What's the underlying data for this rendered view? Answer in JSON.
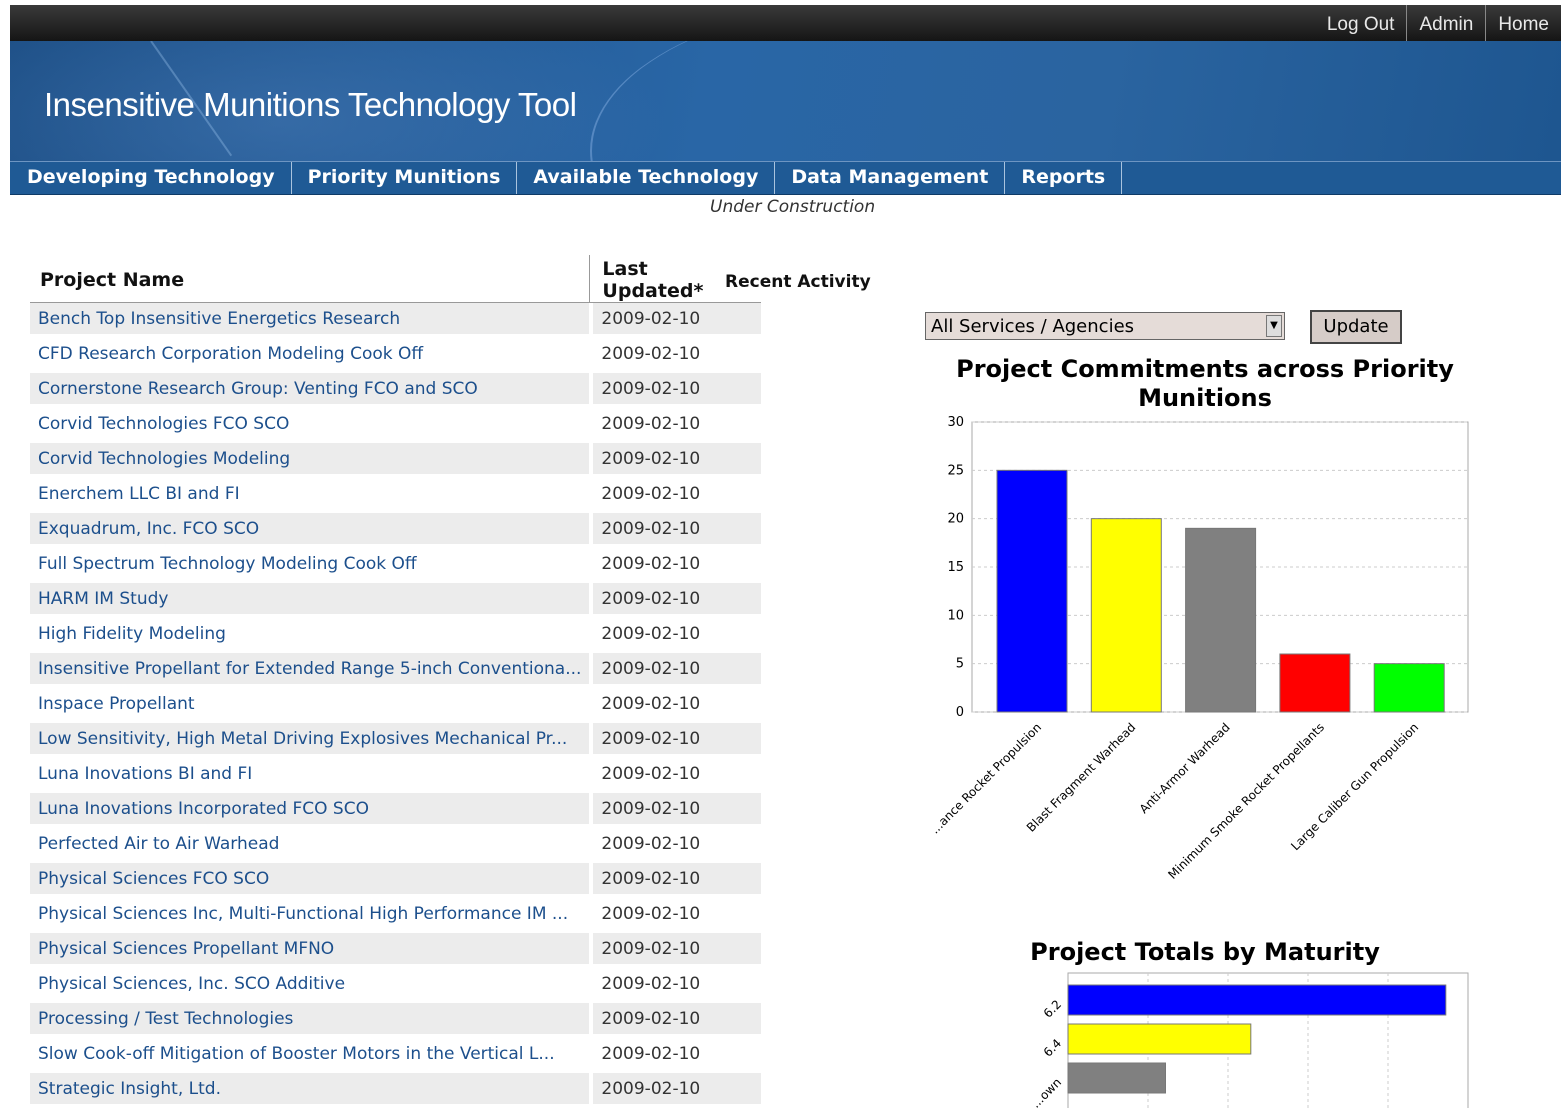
{
  "top_links": [
    "Log Out",
    "Admin",
    "Home"
  ],
  "app_title": "Insensitive Munitions Technology Tool",
  "nav_tabs": [
    "Developing Technology",
    "Priority Munitions",
    "Available Technology",
    "Data Management",
    "Reports"
  ],
  "status_text": "Under Construction",
  "table": {
    "headers": [
      "Project Name",
      "Last Updated*"
    ],
    "rows": [
      [
        "Bench Top Insensitive Energetics Research",
        "2009-02-10"
      ],
      [
        "CFD Research Corporation Modeling Cook Off",
        "2009-02-10"
      ],
      [
        "Cornerstone Research Group: Venting FCO and SCO",
        "2009-02-10"
      ],
      [
        "Corvid Technologies FCO SCO",
        "2009-02-10"
      ],
      [
        "Corvid Technologies Modeling",
        "2009-02-10"
      ],
      [
        "Enerchem LLC BI and FI",
        "2009-02-10"
      ],
      [
        "Exquadrum, Inc. FCO SCO",
        "2009-02-10"
      ],
      [
        "Full Spectrum Technology Modeling Cook Off",
        "2009-02-10"
      ],
      [
        "HARM IM Study",
        "2009-02-10"
      ],
      [
        "High Fidelity Modeling",
        "2009-02-10"
      ],
      [
        "Insensitive Propellant for Extended Range 5-inch Conventiona...",
        "2009-02-10"
      ],
      [
        "Inspace Propellant",
        "2009-02-10"
      ],
      [
        "Low Sensitivity, High Metal Driving Explosives Mechanical Pr...",
        "2009-02-10"
      ],
      [
        "Luna Inovations BI and FI",
        "2009-02-10"
      ],
      [
        "Luna Inovations Incorporated FCO SCO",
        "2009-02-10"
      ],
      [
        "Perfected Air to Air Warhead",
        "2009-02-10"
      ],
      [
        "Physical Sciences FCO SCO",
        "2009-02-10"
      ],
      [
        "Physical Sciences Inc, Multi-Functional High Performance IM ...",
        "2009-02-10"
      ],
      [
        "Physical Sciences Propellant MFNO",
        "2009-02-10"
      ],
      [
        "Physical Sciences, Inc. SCO Additive",
        "2009-02-10"
      ],
      [
        "Processing / Test Technologies",
        "2009-02-10"
      ],
      [
        "Slow Cook-off Mitigation of Booster Motors in the Vertical L...",
        "2009-02-10"
      ],
      [
        "Strategic Insight, Ltd.",
        "2009-02-10"
      ]
    ]
  },
  "recent_activity_label": "Recent Activity",
  "filter": {
    "selected": "All Services / Agencies",
    "button": "Update"
  },
  "chart_data": [
    {
      "type": "bar",
      "title": "Project Commitments across Priority Munitions",
      "categories": [
        "...ance Rocket Propulsion",
        "Blast Fragment Warhead",
        "Anti-Armor Warhead",
        "Minimum Smoke Rocket Propellants",
        "Large Caliber Gun Propulsion"
      ],
      "values": [
        25,
        20,
        19,
        6,
        5
      ],
      "colors": [
        "#0000ff",
        "#ffff00",
        "#808080",
        "#ff0000",
        "#00ff00"
      ],
      "ylim": [
        0,
        30
      ],
      "yticks": [
        0,
        5,
        10,
        15,
        20,
        25,
        30
      ],
      "grid": true
    },
    {
      "type": "bar",
      "orientation": "horizontal",
      "title": "Project Totals by Maturity",
      "categories": [
        "6.2",
        "6.4",
        "...own"
      ],
      "values": [
        31,
        15,
        8
      ],
      "colors": [
        "#0000ff",
        "#ffff00",
        "#808080"
      ],
      "grid": true
    }
  ]
}
